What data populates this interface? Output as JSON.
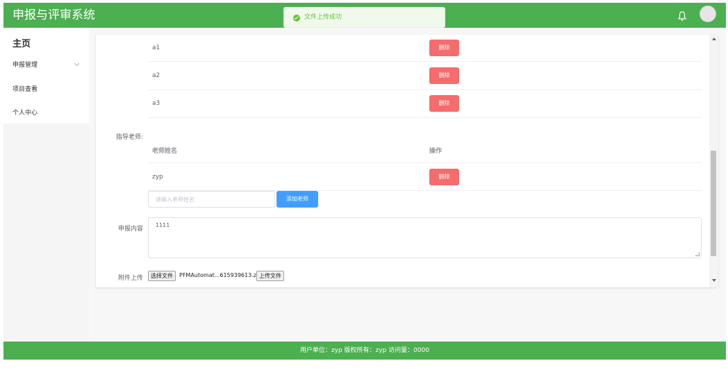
{
  "header": {
    "title": "申报与评审系统",
    "bg_color": "#4caf50",
    "toast": "文件上传成功"
  },
  "sidebar": {
    "home": "主页",
    "items": [
      {
        "label": "申报管理",
        "icon": "chevron-down-icon"
      },
      {
        "label": "项目查看"
      },
      {
        "label": "个人中心"
      }
    ]
  },
  "form": {
    "members": [
      {
        "name": "a1",
        "action": "删除"
      },
      {
        "name": "a2",
        "action": "删除"
      },
      {
        "name": "a3",
        "action": "删除"
      }
    ],
    "teacher_label": "指导老师:",
    "teacher_table": {
      "columns": [
        "老师姓名",
        "操作"
      ],
      "rows": [
        {
          "name": "zyp",
          "action": "删除"
        }
      ]
    },
    "teacher_input_placeholder": "请输入老师姓名",
    "add_teacher": "添加老师",
    "content_label": "申报内容",
    "content_value": "1111",
    "attach_label": "附件上传",
    "choose_file": "选择文件",
    "file_name": "PFMAutomat...615939613.zip",
    "upload_file": "上传文件"
  },
  "footer": {
    "text": "用户单位：zyp 版权所有：zyp 访问量：0000"
  },
  "colors": {
    "danger": "#f56c6c",
    "primary": "#409eff",
    "success": "#67c23a"
  }
}
